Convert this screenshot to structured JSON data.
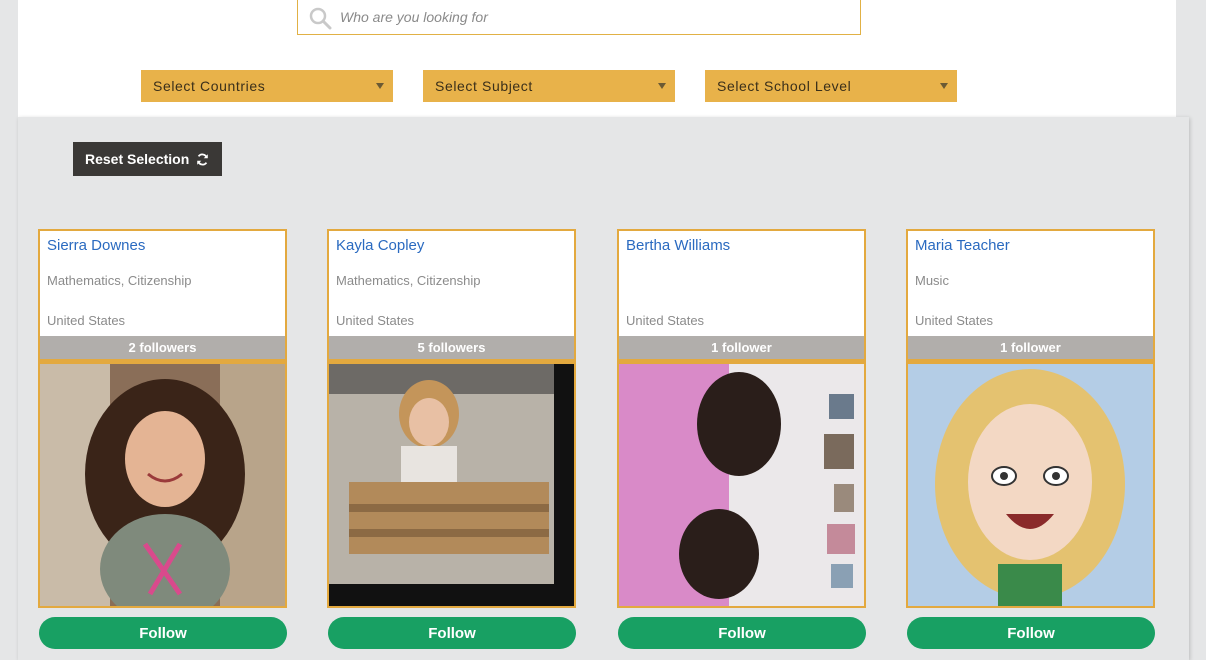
{
  "search": {
    "placeholder": "Who are you looking for"
  },
  "filters": [
    {
      "label": "Select Countries"
    },
    {
      "label": "Select Subject"
    },
    {
      "label": "Select School Level"
    }
  ],
  "reset": {
    "label": "Reset Selection"
  },
  "colors": {
    "accent": "#e3a93f",
    "filter_bg": "#e8b24a",
    "name_link": "#2a6ac0",
    "follow_green": "#18a063",
    "followers_bar": "#b1aeab",
    "reset_bg": "#3a3836"
  },
  "cards": [
    {
      "name": "Sierra Downes",
      "subjects": "Mathematics, Citizenship",
      "country": "United States",
      "followers": "2 followers",
      "follow_label": "Follow"
    },
    {
      "name": "Kayla Copley",
      "subjects": "Mathematics, Citizenship",
      "country": "United States",
      "followers": "5 followers",
      "follow_label": "Follow"
    },
    {
      "name": "Bertha Williams",
      "subjects": "",
      "country": "United States",
      "followers": "1 follower",
      "follow_label": "Follow"
    },
    {
      "name": "Maria Teacher",
      "subjects": "Music",
      "country": "United States",
      "followers": "1 follower",
      "follow_label": "Follow"
    }
  ]
}
